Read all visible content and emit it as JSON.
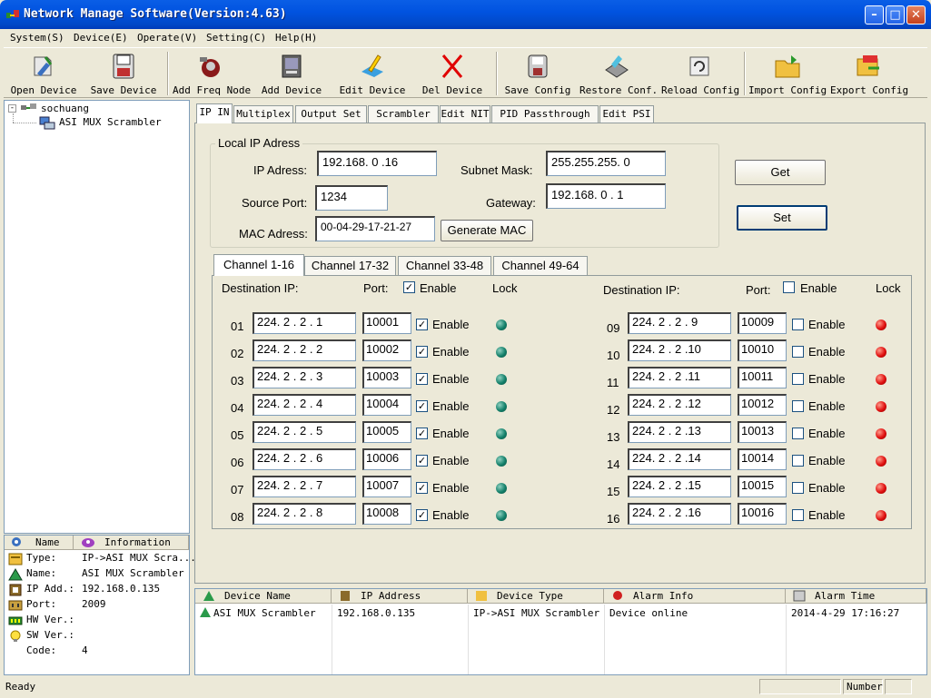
{
  "window": {
    "title": "Network Manage Software(Version:4.63)"
  },
  "menu": [
    "System(S)",
    "Device(E)",
    "Operate(V)",
    "Setting(C)",
    "Help(H)"
  ],
  "toolbar": [
    {
      "label": "Open Device",
      "icon": "open-device-icon"
    },
    {
      "label": "Save Device",
      "icon": "save-device-icon"
    },
    {
      "label": "Add Freq Node",
      "icon": "add-freq-node-icon"
    },
    {
      "label": "Add Device",
      "icon": "add-device-icon"
    },
    {
      "label": "Edit Device",
      "icon": "edit-device-icon"
    },
    {
      "label": "Del Device",
      "icon": "del-device-icon"
    },
    {
      "label": "Save Config",
      "icon": "save-config-icon"
    },
    {
      "label": "Restore Conf.",
      "icon": "restore-config-icon"
    },
    {
      "label": "Reload Config",
      "icon": "reload-config-icon"
    },
    {
      "label": "Import Config",
      "icon": "import-config-icon"
    },
    {
      "label": "Export Config",
      "icon": "export-config-icon"
    }
  ],
  "tree": {
    "root": "sochuang",
    "child": "ASI MUX Scrambler"
  },
  "info_panel": {
    "headers": [
      "Name",
      "Information"
    ],
    "rows": [
      {
        "name": "Type:",
        "value": "IP->ASI MUX Scra..."
      },
      {
        "name": "Name:",
        "value": "ASI MUX Scrambler"
      },
      {
        "name": "IP Add.:",
        "value": "192.168.0.135"
      },
      {
        "name": "Port:",
        "value": "2009"
      },
      {
        "name": "HW Ver.:",
        "value": ""
      },
      {
        "name": "SW Ver.:",
        "value": ""
      },
      {
        "name": "Code:",
        "value": "4"
      }
    ]
  },
  "tabs": [
    "IP IN",
    "Multiplex",
    "Output Set",
    "Scrambler",
    "Edit NIT",
    "PID Passthrough",
    "Edit PSI"
  ],
  "local_ip": {
    "group_title": "Local IP Adress",
    "ip_label": "IP Adress:",
    "ip_value": "192.168. 0 .16",
    "mask_label": "Subnet Mask:",
    "mask_value": "255.255.255. 0",
    "port_label": "Source Port:",
    "port_value": "1234",
    "gateway_label": "Gateway:",
    "gateway_value": "192.168. 0 . 1",
    "mac_label": "MAC Adress:",
    "mac_value": "00-04-29-17-21-27",
    "generate_mac": "Generate MAC",
    "get_label": "Get",
    "set_label": "Set"
  },
  "channel_tabs": [
    "Channel 1-16",
    "Channel 17-32",
    "Channel 33-48",
    "Channel 49-64"
  ],
  "channel_headers": {
    "dest": "Destination IP:",
    "port": "Port:",
    "enable": "Enable",
    "lock": "Lock"
  },
  "channels_left": [
    {
      "num": "01",
      "ip": "224. 2 . 2 . 1",
      "port": "10001",
      "enable_label": "Enable"
    },
    {
      "num": "02",
      "ip": "224. 2 . 2 . 2",
      "port": "10002",
      "enable_label": "Enable"
    },
    {
      "num": "03",
      "ip": "224. 2 . 2 . 3",
      "port": "10003",
      "enable_label": "Enable"
    },
    {
      "num": "04",
      "ip": "224. 2 . 2 . 4",
      "port": "10004",
      "enable_label": "Enable"
    },
    {
      "num": "05",
      "ip": "224. 2 . 2 . 5",
      "port": "10005",
      "enable_label": "Enable"
    },
    {
      "num": "06",
      "ip": "224. 2 . 2 . 6",
      "port": "10006",
      "enable_label": "Enable"
    },
    {
      "num": "07",
      "ip": "224. 2 . 2 . 7",
      "port": "10007",
      "enable_label": "Enable"
    },
    {
      "num": "08",
      "ip": "224. 2 . 2 . 8",
      "port": "10008",
      "enable_label": "Enable"
    }
  ],
  "channels_right": [
    {
      "num": "09",
      "ip": "224. 2 . 2 . 9",
      "port": "10009",
      "enable_label": "Enable"
    },
    {
      "num": "10",
      "ip": "224. 2 . 2 .10",
      "port": "10010",
      "enable_label": "Enable"
    },
    {
      "num": "11",
      "ip": "224. 2 . 2 .11",
      "port": "10011",
      "enable_label": "Enable"
    },
    {
      "num": "12",
      "ip": "224. 2 . 2 .12",
      "port": "10012",
      "enable_label": "Enable"
    },
    {
      "num": "13",
      "ip": "224. 2 . 2 .13",
      "port": "10013",
      "enable_label": "Enable"
    },
    {
      "num": "14",
      "ip": "224. 2 . 2 .14",
      "port": "10014",
      "enable_label": "Enable"
    },
    {
      "num": "15",
      "ip": "224. 2 . 2 .15",
      "port": "10015",
      "enable_label": "Enable"
    },
    {
      "num": "16",
      "ip": "224. 2 . 2 .16",
      "port": "10016",
      "enable_label": "Enable"
    }
  ],
  "left_enabled": true,
  "right_enabled": false,
  "lock_colors": {
    "locked": "#13806a",
    "unlocked": "#e01010"
  },
  "device_grid": {
    "headers": [
      "Device Name",
      "IP Address",
      "Device Type",
      "Alarm Info",
      "Alarm Time"
    ],
    "rows": [
      [
        "ASI MUX Scrambler",
        "192.168.0.135",
        "IP->ASI MUX Scrambler",
        "Device online",
        "2014-4-29 17:16:27"
      ]
    ]
  },
  "status": {
    "text": "Ready",
    "number": "Number"
  }
}
